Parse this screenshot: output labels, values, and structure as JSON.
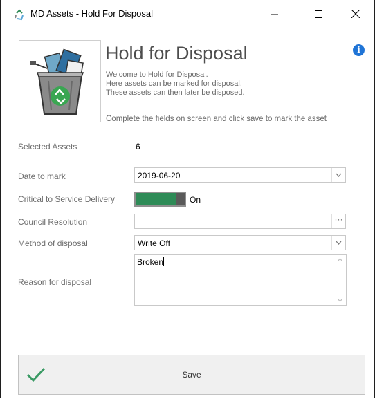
{
  "window": {
    "title": "MD Assets - Hold For Disposal",
    "minimize_icon": "minimize-icon",
    "maximize_icon": "maximize-icon",
    "close_icon": "close-icon"
  },
  "header": {
    "title": "Hold for Disposal",
    "welcome_lines": [
      "Welcome to Hold for Disposal.",
      "Here assets can be marked for disposal.",
      "These assets can then later be disposed."
    ],
    "instruction": "Complete the fields on screen and click save to mark the asset",
    "hero_icon": "recycle-bin-icon",
    "info_icon": "info-icon",
    "info_glyph": "i"
  },
  "form": {
    "selected_assets": {
      "label": "Selected Assets",
      "value": "6"
    },
    "date_to_mark": {
      "label": "Date to mark",
      "value": "2019-06-20"
    },
    "critical": {
      "label": "Critical to Service Delivery",
      "state_label": "On",
      "on": true
    },
    "council_resolution": {
      "label": "Council Resolution",
      "value": "",
      "ellipsis": "···"
    },
    "method": {
      "label": "Method of disposal",
      "value": "Write Off"
    },
    "reason": {
      "label": "Reason for disposal",
      "value": "Broken"
    }
  },
  "footer": {
    "save_label": "Save",
    "save_icon": "checkmark-icon"
  },
  "colors": {
    "toggle_on": "#2e8b57",
    "info_blue": "#1f74d6",
    "check_green": "#3a9a64"
  }
}
